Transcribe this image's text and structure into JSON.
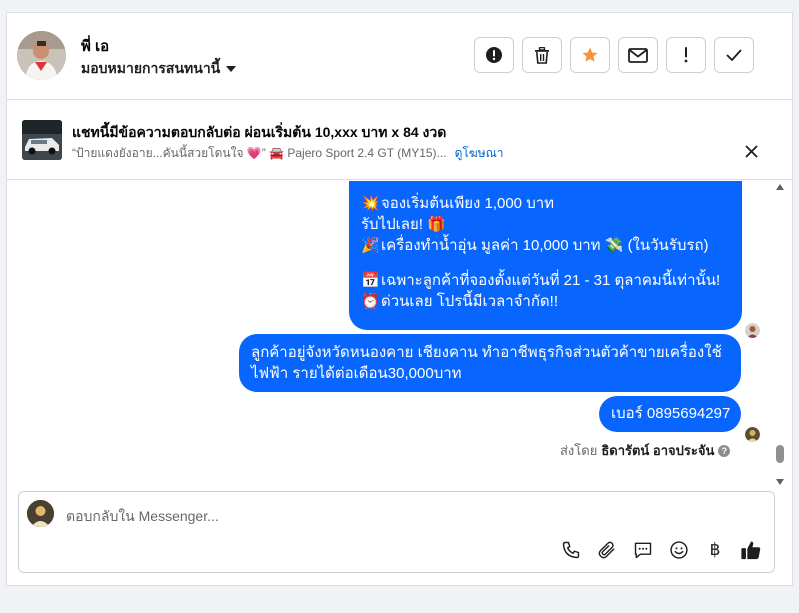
{
  "header": {
    "name": "พี่ เอ",
    "assign_label": "มอบหมายการสนทนานี้",
    "actions": [
      {
        "icon": "alert-circle-icon"
      },
      {
        "icon": "trash-icon"
      },
      {
        "icon": "star-icon",
        "color": "#f7923b"
      },
      {
        "icon": "envelope-icon"
      },
      {
        "icon": "exclamation-icon"
      },
      {
        "icon": "check-icon"
      }
    ]
  },
  "ad": {
    "title": "แชทนี้มีข้อความตอบกลับต่อ ผ่อนเริ่มต้น 10,xxx บาท x 84 งวด",
    "subtitle": "“ป้ายแดงยังอาย...คันนี้สวยโดนใจ 💗” 🚘 Pajero Sport 2.4 GT (MY15)...",
    "link": "ดูโฆษณา"
  },
  "messages": {
    "bubble1": [
      {
        "emoji": "💥",
        "text": "จองเริ่มต้นเพียง 1,000 บาท"
      },
      {
        "emoji": "",
        "text": "รับไปเลย! 🎁"
      },
      {
        "emoji": "🎉",
        "text": "เครื่องทำน้ำอุ่น มูลค่า 10,000 บาท 💸 (ในวันรับรถ)"
      },
      {
        "emoji": "📅",
        "text": "เฉพาะลูกค้าที่จองตั้งแต่วันที่ 21 - 31 ตุลาคมนี้เท่านั้น!"
      },
      {
        "emoji": "⏰",
        "text": "ด่วนเลย โปรนี้มีเวลาจำกัด!!"
      }
    ],
    "bubble2": [
      "ลูกค้าอยู่จังหวัดหนองคาย เชียงคาน ทำอาชีพธุรกิจส่วนตัวค้าขายเครื่องใช้",
      "ไฟฟ้า รายได้ต่อเดือน30,000บาท"
    ],
    "bubble3": "เบอร์ 0895694297",
    "sent_by_prefix": "ส่งโดย",
    "sent_by_name": "ธิดารัตน์ อาจประจัน",
    "accent": "#0866ff"
  },
  "composer": {
    "placeholder": "ตอบกลับใน Messenger...",
    "tools": [
      "phone-icon",
      "paperclip-icon",
      "saved-reply-icon",
      "emoji-icon",
      "baht-icon",
      "thumbs-up-icon"
    ],
    "baht_symbol": "฿"
  }
}
